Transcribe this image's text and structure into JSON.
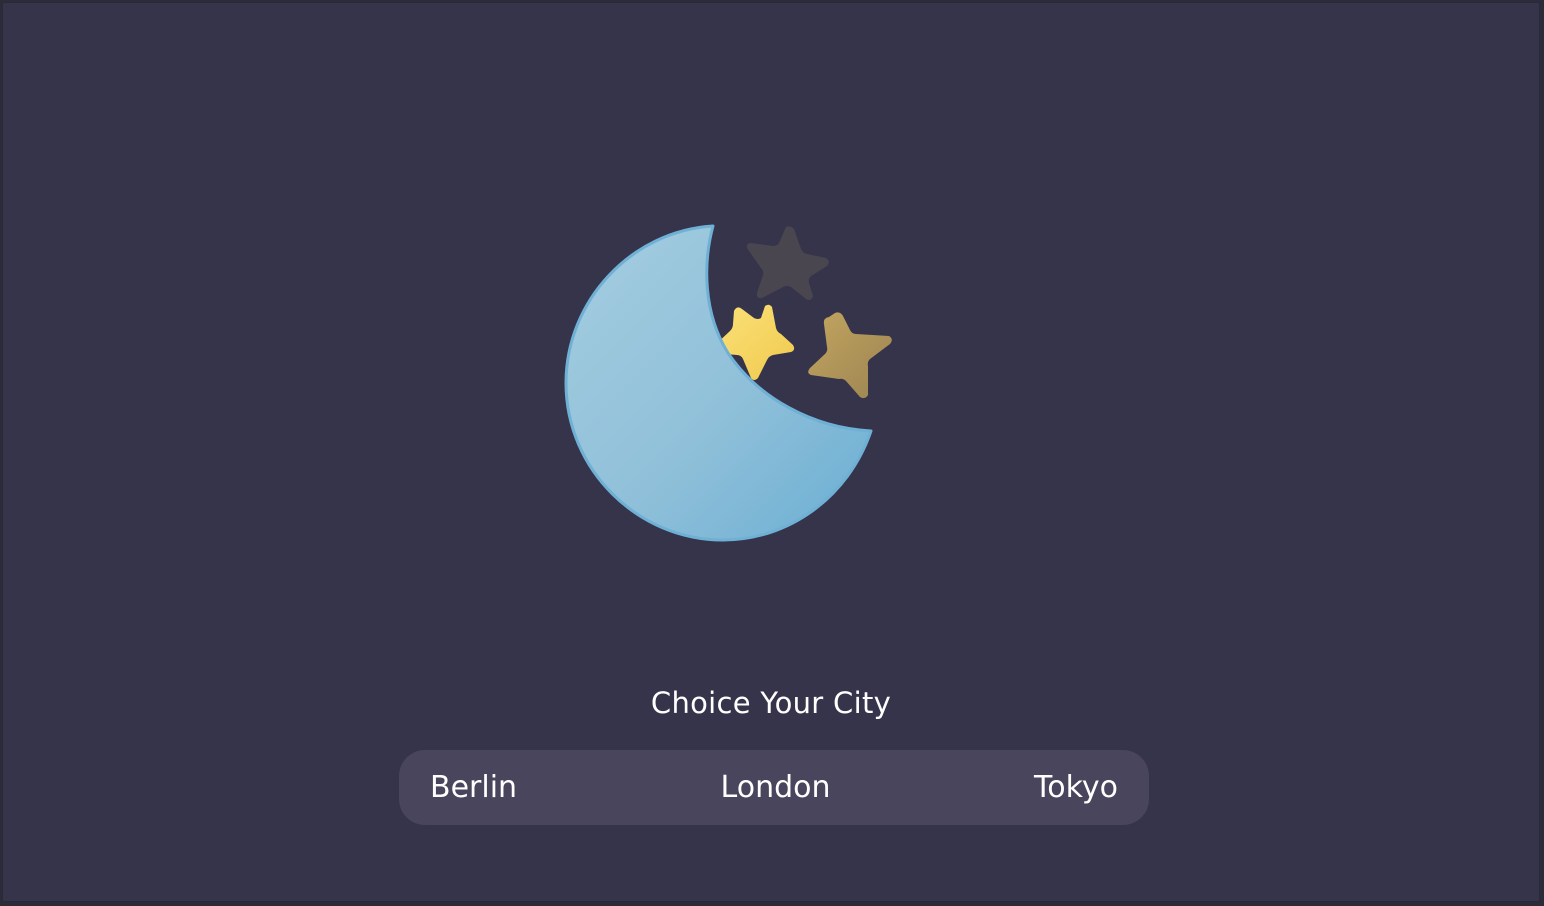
{
  "illustration": {
    "icon": "moon-and-stars-icon",
    "colors": {
      "moon": "#8fc0da",
      "moon_shadow": "#6fb0d5",
      "star_bright": "#f7d563",
      "star_gold": "#b0975a",
      "star_dark": "#4a4650"
    }
  },
  "prompt": {
    "text": "Choice Your City"
  },
  "cities": [
    {
      "label": "Berlin"
    },
    {
      "label": "London"
    },
    {
      "label": "Tokyo"
    }
  ],
  "theme": {
    "background": "#36344b",
    "bar": "#48455c",
    "text": "#ffffff"
  }
}
